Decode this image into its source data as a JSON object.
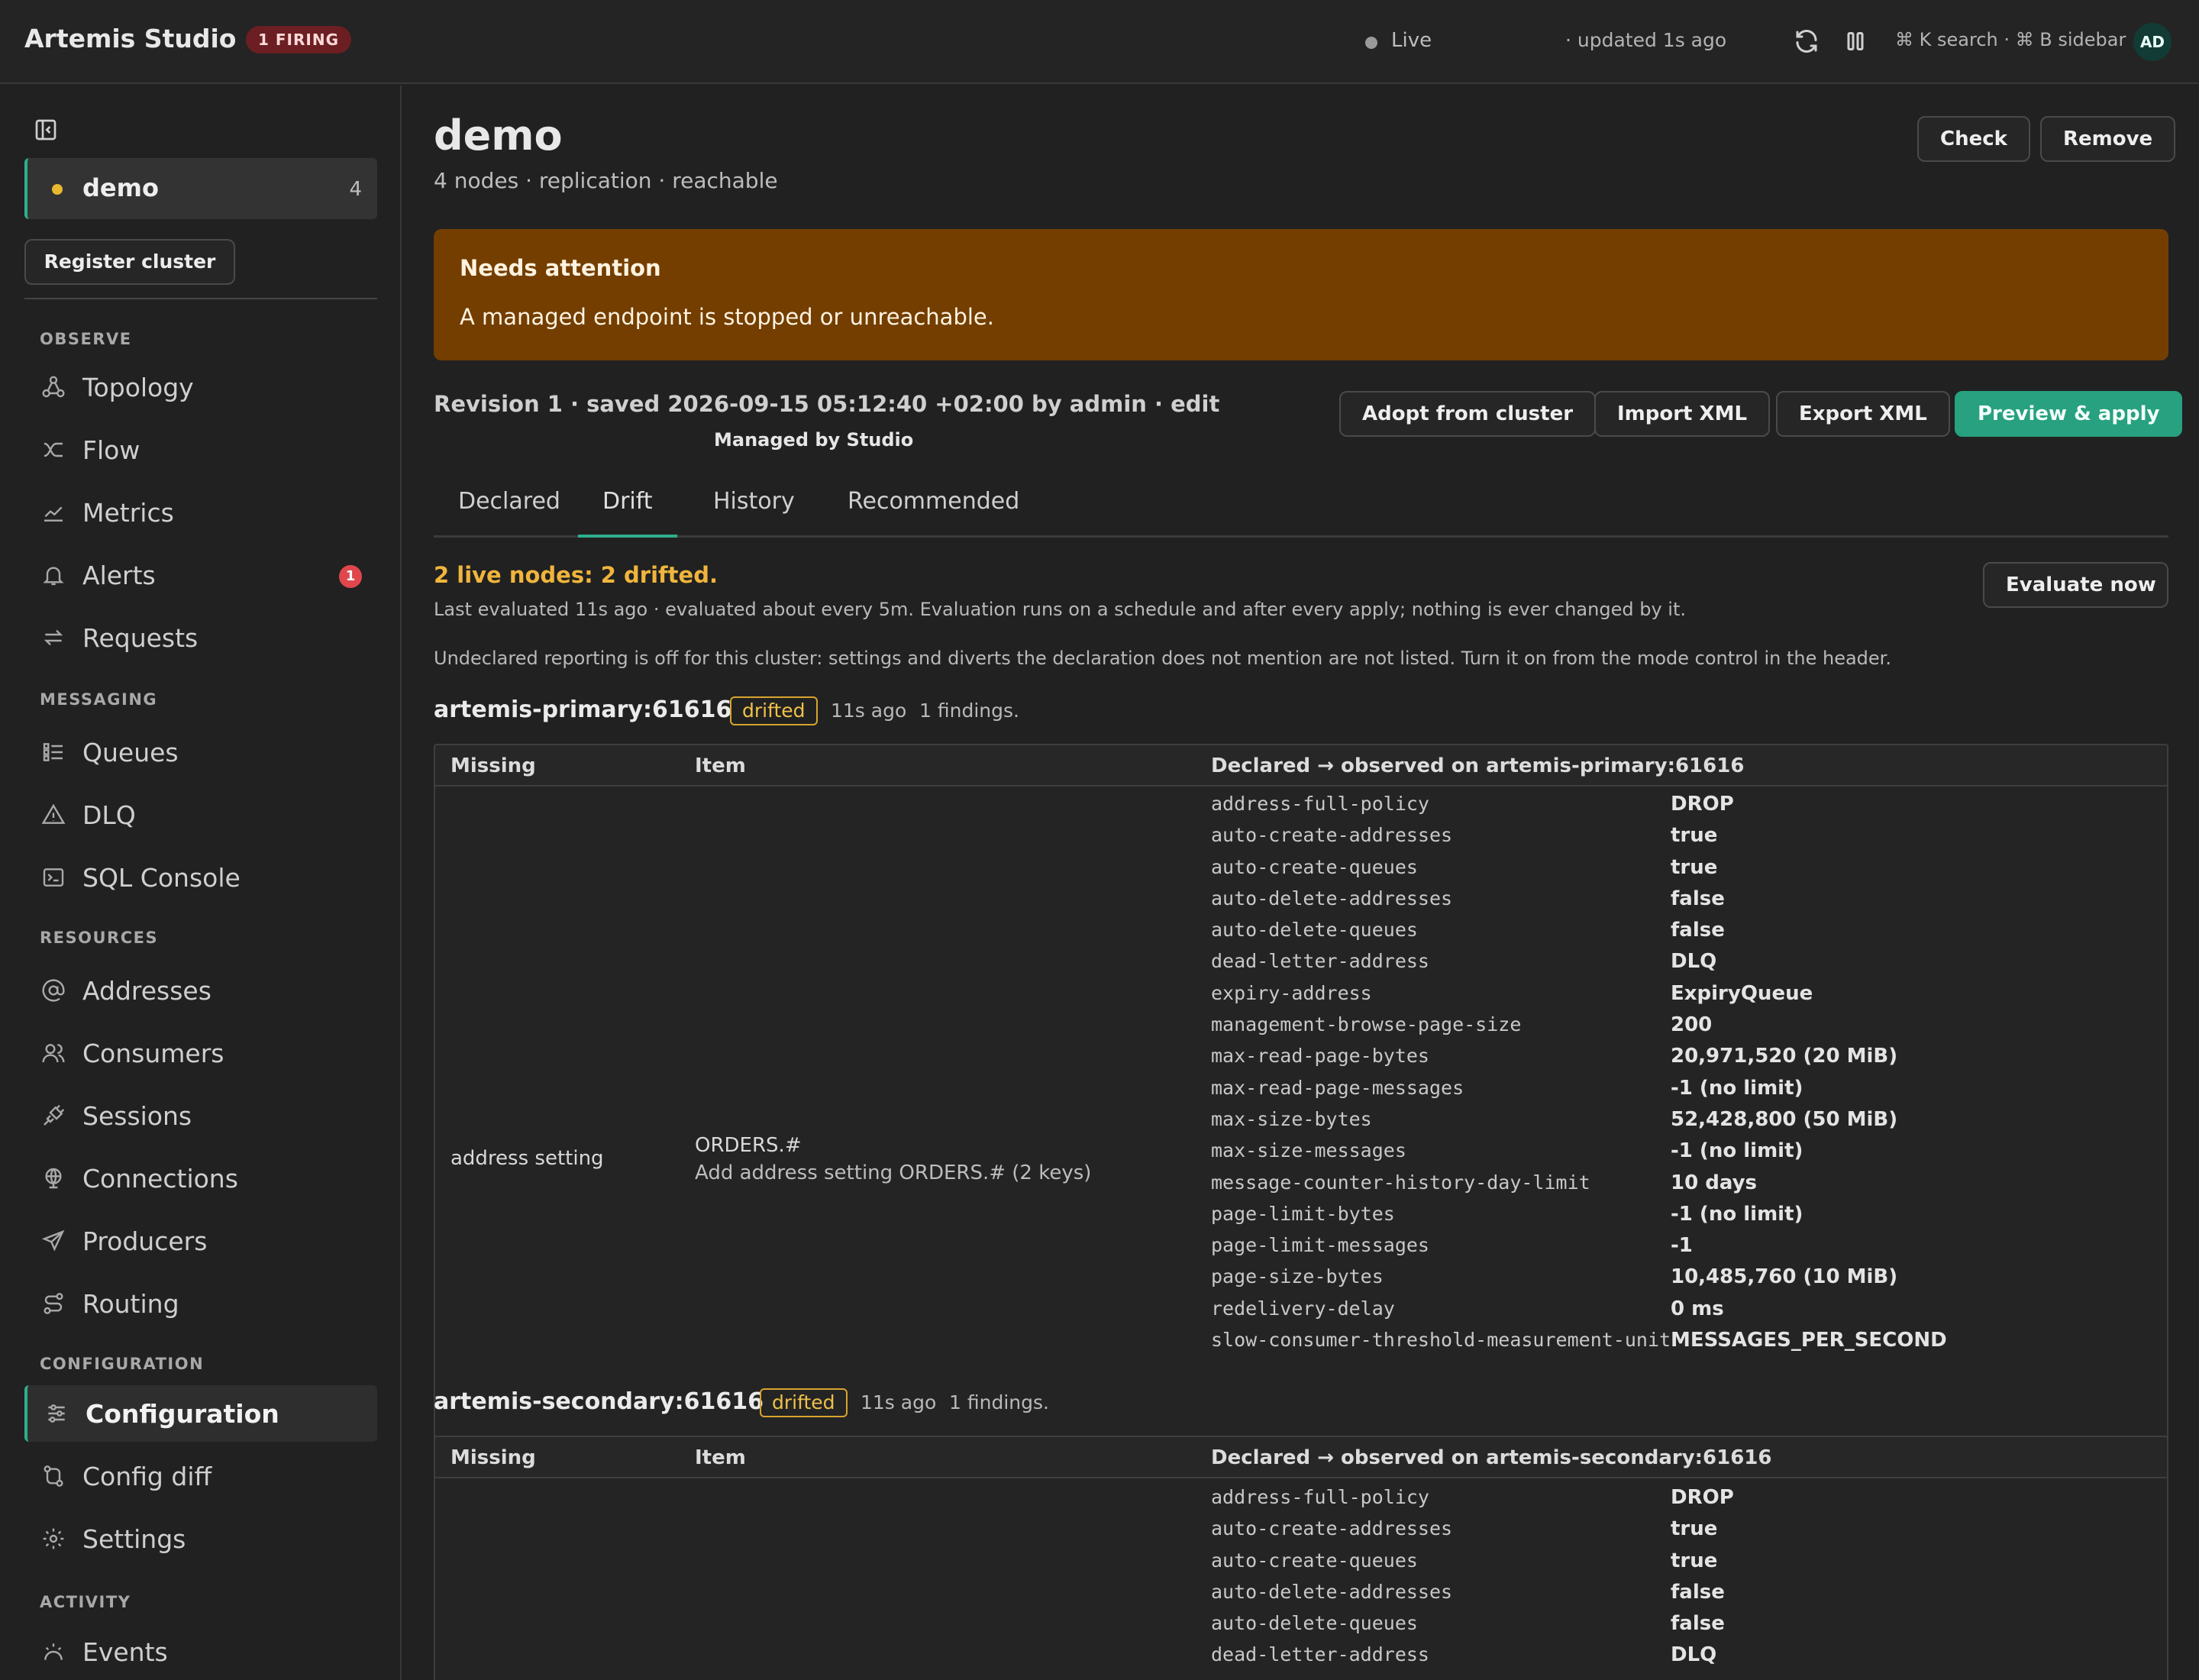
{
  "app": {
    "title": "Artemis Studio",
    "firing_badge": "1 FIRING"
  },
  "topbar": {
    "live_label": "Live",
    "updated": "· updated 1s ago",
    "shortcuts": "⌘ K search · ⌘ B sidebar",
    "avatar": "AD",
    "icons": [
      "refresh-icon",
      "pause-icon"
    ]
  },
  "sidebar": {
    "cluster": {
      "name": "demo",
      "count": "4"
    },
    "register_label": "Register cluster",
    "sections": {
      "observe": "OBSERVE",
      "messaging": "MESSAGING",
      "resources": "RESOURCES",
      "configuration": "CONFIGURATION",
      "activity": "ACTIVITY"
    },
    "items": {
      "topology": "Topology",
      "flow": "Flow",
      "metrics": "Metrics",
      "alerts": "Alerts",
      "alerts_count": "1",
      "requests": "Requests",
      "queues": "Queues",
      "dlq": "DLQ",
      "sql": "SQL Console",
      "addresses": "Addresses",
      "consumers": "Consumers",
      "sessions": "Sessions",
      "connections": "Connections",
      "producers": "Producers",
      "routing": "Routing",
      "configuration": "Configuration",
      "config_diff": "Config diff",
      "settings": "Settings",
      "events": "Events"
    }
  },
  "main": {
    "title": "demo",
    "subtitle": "4 nodes · replication · reachable",
    "check_label": "Check",
    "remove_label": "Remove",
    "attention": {
      "title": "Needs attention",
      "text": "A managed endpoint is stopped or unreachable."
    },
    "revision": "Revision 1 · saved 2026-09-15 05:12:40 +02:00 by admin · edit",
    "managed": "Managed by Studio",
    "actions": {
      "adopt": "Adopt from cluster",
      "import": "Import XML",
      "export": "Export XML",
      "preview": "Preview & apply"
    },
    "tabs": {
      "declared": "Declared",
      "drift": "Drift",
      "history": "History",
      "recommended": "Recommended"
    },
    "drift": {
      "headline": "2 live nodes: 2 drifted.",
      "evaluate_label": "Evaluate now",
      "evaluated_note": "Last evaluated 11s ago · evaluated about every 5m. Evaluation runs on a schedule and after every apply; nothing is ever changed by it.",
      "undeclared_note": "Undeclared reporting is off for this cluster: settings and diverts the declaration does not mention are not listed. Turn it on from the mode control in the header."
    },
    "nodes": [
      {
        "name": "artemis-primary:61616",
        "badge": "drifted",
        "age": "11s ago",
        "findings": "1 findings.",
        "headers": {
          "missing": "Missing",
          "item": "Item",
          "observed": "Declared → observed on artemis-primary:61616"
        },
        "row": {
          "missing": "address setting",
          "item": "ORDERS.#",
          "item_desc": "Add address setting ORDERS.# (2 keys)"
        },
        "settings": [
          {
            "key": "address-full-policy",
            "value": "DROP"
          },
          {
            "key": "auto-create-addresses",
            "value": "true"
          },
          {
            "key": "auto-create-queues",
            "value": "true"
          },
          {
            "key": "auto-delete-addresses",
            "value": "false"
          },
          {
            "key": "auto-delete-queues",
            "value": "false"
          },
          {
            "key": "dead-letter-address",
            "value": "DLQ"
          },
          {
            "key": "expiry-address",
            "value": "ExpiryQueue"
          },
          {
            "key": "management-browse-page-size",
            "value": "200"
          },
          {
            "key": "max-read-page-bytes",
            "value": "20,971,520 (20 MiB)"
          },
          {
            "key": "max-read-page-messages",
            "value": "-1 (no limit)"
          },
          {
            "key": "max-size-bytes",
            "value": "52,428,800 (50 MiB)"
          },
          {
            "key": "max-size-messages",
            "value": "-1 (no limit)"
          },
          {
            "key": "message-counter-history-day-limit",
            "value": "10 days"
          },
          {
            "key": "page-limit-bytes",
            "value": "-1 (no limit)"
          },
          {
            "key": "page-limit-messages",
            "value": "-1"
          },
          {
            "key": "page-size-bytes",
            "value": "10,485,760 (10 MiB)"
          },
          {
            "key": "redelivery-delay",
            "value": "0 ms"
          },
          {
            "key": "slow-consumer-threshold-measurement-unit",
            "value": "MESSAGES_PER_SECOND"
          }
        ]
      },
      {
        "name": "artemis-secondary:61616",
        "badge": "drifted",
        "age": "11s ago",
        "findings": "1 findings.",
        "headers": {
          "missing": "Missing",
          "item": "Item",
          "observed": "Declared → observed on artemis-secondary:61616"
        },
        "settings": [
          {
            "key": "address-full-policy",
            "value": "DROP"
          },
          {
            "key": "auto-create-addresses",
            "value": "true"
          },
          {
            "key": "auto-create-queues",
            "value": "true"
          },
          {
            "key": "auto-delete-addresses",
            "value": "false"
          },
          {
            "key": "auto-delete-queues",
            "value": "false"
          },
          {
            "key": "dead-letter-address",
            "value": "DLQ"
          }
        ]
      }
    ]
  }
}
